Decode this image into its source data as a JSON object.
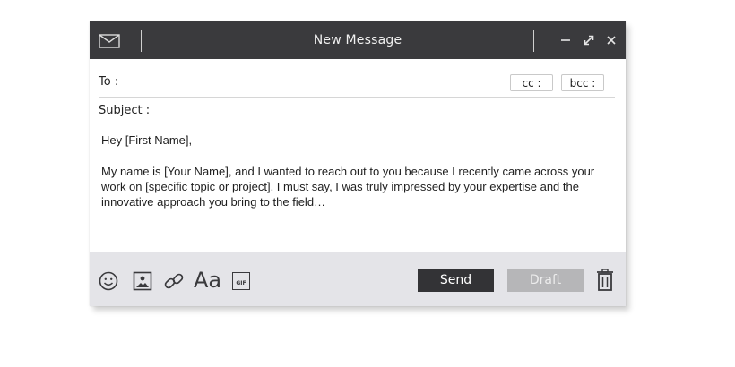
{
  "window": {
    "title": "New Message",
    "controls": {
      "minimize_icon": "minimize-icon",
      "expand_icon": "expand-icon",
      "close_icon": "close-icon"
    },
    "mail_icon": "mail-icon"
  },
  "fields": {
    "to_label": "To :",
    "cc_label": "cc :",
    "bcc_label": "bcc :",
    "subject_label": "Subject :"
  },
  "message": {
    "greeting": "Hey [First Name],",
    "paragraph": "My name is [Your Name], and I wanted to reach out to you because I recently came across your work on [specific topic or project]. I must say, I was truly impressed by your expertise and the innovative approach you bring to the field…"
  },
  "toolbar": {
    "font_label": "Aa",
    "gif_label": "GIF",
    "send_label": "Send",
    "draft_label": "Draft",
    "icons": [
      "emoji-icon",
      "image-icon",
      "link-icon",
      "font-icon",
      "gif-icon",
      "trash-icon"
    ]
  },
  "colors": {
    "titlebar": "#3a3a3d",
    "footer": "#e4e4e8",
    "send_button": "#333336",
    "draft_button": "#b6b6b8"
  }
}
